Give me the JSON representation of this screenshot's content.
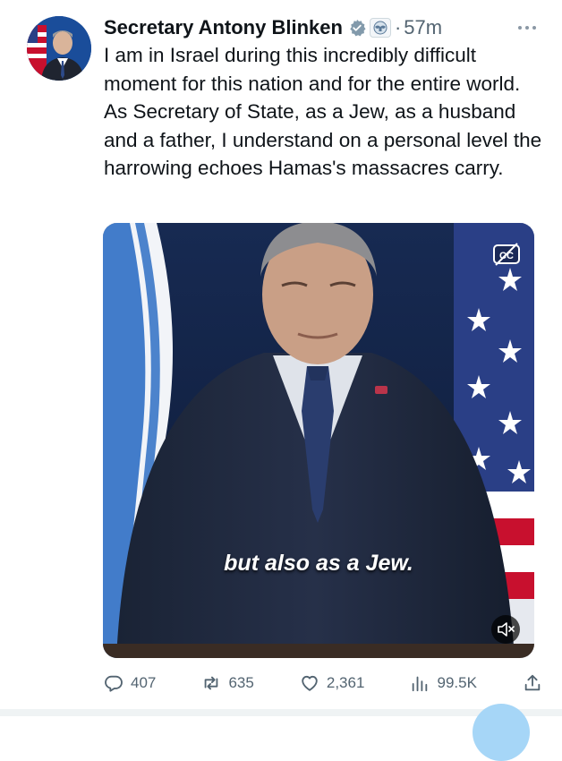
{
  "tweet": {
    "display_name": "Secretary Antony Blinken",
    "timestamp": "57m",
    "separator": "·",
    "text": "I am in Israel during this incredibly difficult moment for this nation and for the entire world. As Secretary of State, as a Jew, as a husband and a father, I understand on a personal level the harrowing echoes Hamas's massacres carry."
  },
  "media": {
    "caption": "but also as a Jew."
  },
  "actions": {
    "replies": "407",
    "reposts": "635",
    "likes": "2,361",
    "views": "99.5K"
  },
  "colors": {
    "text": "#0f1419",
    "secondary": "#536471",
    "verified": "#829aab"
  }
}
